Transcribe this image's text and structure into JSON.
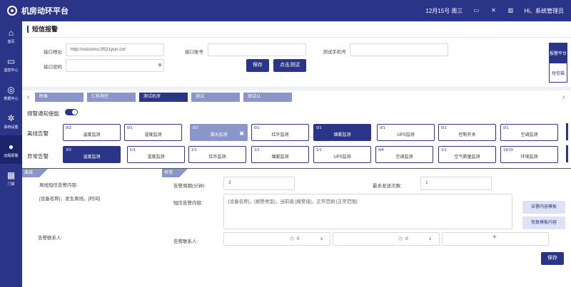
{
  "app": {
    "title": "机房动环平台"
  },
  "header": {
    "date": "12月15号 周三",
    "user": "Hi，系统管理员"
  },
  "sidebar": {
    "items": [
      {
        "label": "首页",
        "icon": "home-icon"
      },
      {
        "label": "监控中心",
        "icon": "monitor-icon"
      },
      {
        "label": "数据中心",
        "icon": "data-icon"
      },
      {
        "label": "系统设置",
        "icon": "gear-icon"
      },
      {
        "label": "远程报警",
        "icon": "bulb-icon"
      },
      {
        "label": "门禁",
        "icon": "door-icon"
      }
    ]
  },
  "page": {
    "title": "短信报警"
  },
  "form": {
    "url_label": "接口地址",
    "url_value": "http://voicsms.0531yun.cn/",
    "account_label": "接口账号",
    "account_value": "",
    "phone_label": "测试手机号",
    "phone_value": "",
    "password_label": "接口密码",
    "password_value": "",
    "save": "保存",
    "test": "点击测试"
  },
  "side_tabs": [
    "报警平台",
    "短信猫"
  ],
  "tabs": [
    "晖泰",
    "仁科测控",
    "测试机房",
    "测试",
    "测试11"
  ],
  "toggle_label": "频警通知使能",
  "rows": {
    "offline_label": "离线告警",
    "offline": [
      {
        "count": "0/3",
        "name": "温度监测"
      },
      {
        "count": "0/1",
        "name": "湿度监测"
      },
      {
        "count": "0/2",
        "name": "漏水监测"
      },
      {
        "count": "0/1",
        "name": "红外监测"
      },
      {
        "count": "0/1",
        "name": "烟雾监测"
      },
      {
        "count": "0/1",
        "name": "UPS监测"
      },
      {
        "count": "0/1",
        "name": "控制开关"
      },
      {
        "count": "0/1",
        "name": "空调监测"
      }
    ],
    "alarm_label": "异常告警",
    "alarm": [
      {
        "count": "3/3",
        "name": "温度监测"
      },
      {
        "count": "1/1",
        "name": "湿度监测"
      },
      {
        "count": "1/1",
        "name": "红外监测"
      },
      {
        "count": "1/1",
        "name": "烟雾监测"
      },
      {
        "count": "1/1",
        "name": "UPS监测"
      },
      {
        "count": "4/4",
        "name": "空调监测"
      },
      {
        "count": "1/1",
        "name": "空气质量监测"
      },
      {
        "count": "19/19",
        "name": "环境监测"
      }
    ]
  },
  "left_panel": {
    "tag": "离线",
    "content_label": "离线短信告警内容:",
    "content": "[设备名称]，发生离线，[时间]",
    "contact_label": "告警联系人:"
  },
  "right_panel": {
    "tag": "异常",
    "period_label": "告警周期(分钟):",
    "period_value": "3",
    "max_label": "最多发送次数:",
    "max_value": "1",
    "content_label": "短信告警内容:",
    "content": "[设备名称]，[报警类型]，当前值:[报警值]，正常范围:[正常范围]",
    "template_btn": "告警内容模板",
    "restore_btn": "恢复模板内容",
    "contact_label": "告警联系人:",
    "contact1_delay": "0",
    "contact2_delay": "0",
    "unit": "s",
    "add": "+",
    "save": "保存"
  }
}
